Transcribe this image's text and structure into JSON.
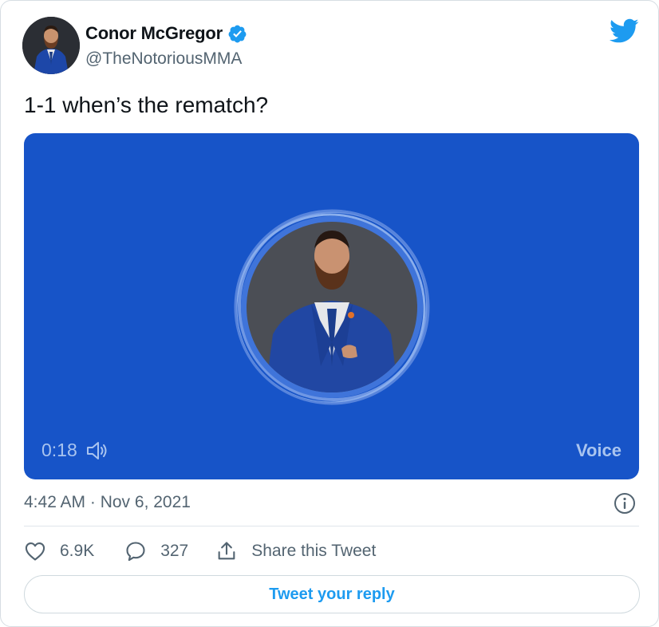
{
  "author": {
    "display_name": "Conor McGregor",
    "handle": "@TheNotoriousMMA",
    "verified": true
  },
  "tweet": {
    "text": "1-1 when’s the rematch?",
    "timestamp": "4:42 AM · Nov 6, 2021"
  },
  "media": {
    "type": "voice",
    "duration": "0:18",
    "label": "Voice",
    "background_color": "#1754c8"
  },
  "stats": {
    "likes": "6.9K",
    "replies": "327",
    "share_label": "Share this Tweet"
  },
  "reply": {
    "button_label": "Tweet your reply"
  },
  "icons": [
    "verified-badge-icon",
    "twitter-bird-icon",
    "speaker-icon",
    "info-icon",
    "heart-icon",
    "reply-bubble-icon",
    "share-icon"
  ],
  "colors": {
    "accent": "#1d9bf0",
    "secondary_text": "#536471",
    "media_text": "#a9c4ef"
  }
}
